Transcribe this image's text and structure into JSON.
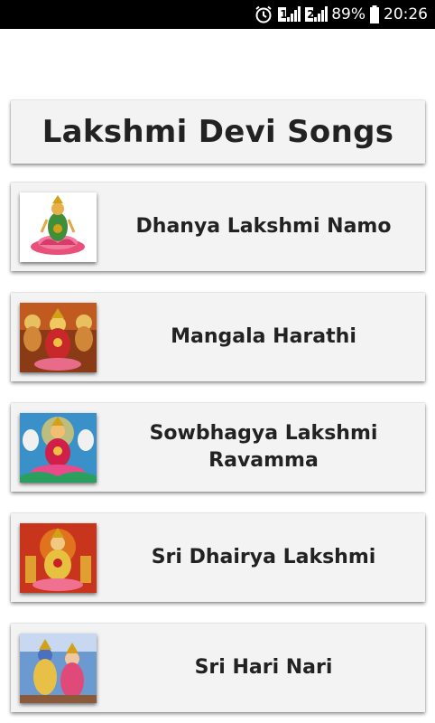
{
  "status_bar": {
    "battery_percent": "89%",
    "time": "20:26",
    "sim1": "1",
    "sim2": "2"
  },
  "app": {
    "title": "Lakshmi Devi Songs"
  },
  "songs": [
    {
      "title": "Dhanya Lakshmi Namo"
    },
    {
      "title": "Mangala Harathi"
    },
    {
      "title": "Sowbhagya Lakshmi Ravamma"
    },
    {
      "title": "Sri Dhairya Lakshmi"
    },
    {
      "title": "Sri Hari Nari"
    }
  ]
}
